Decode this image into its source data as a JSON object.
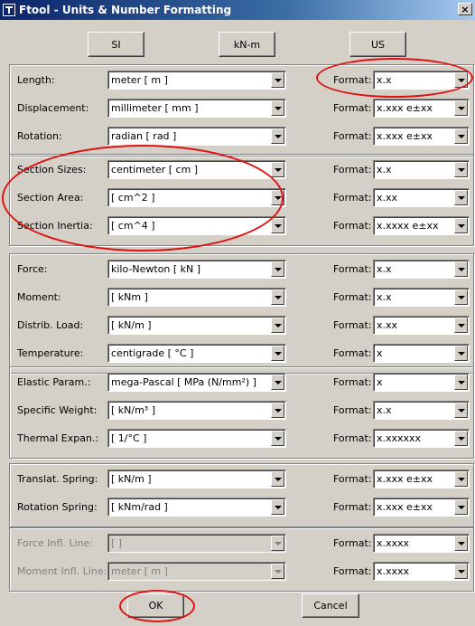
{
  "window": {
    "title": "Ftool - Units & Number Formatting",
    "close_glyph": "×"
  },
  "presets": {
    "si": "SI",
    "kn": "kN-m",
    "us": "US"
  },
  "format_label": "Format:",
  "groups": [
    {
      "rows": [
        {
          "label": "Length:",
          "unit": "meter [ m ]",
          "format": "x.x"
        },
        {
          "label": "Displacement:",
          "unit": "millimeter [ mm ]",
          "format": "x.xxx e±xx"
        },
        {
          "label": "Rotation:",
          "unit": "radian [ rad ]",
          "format": "x.xxx e±xx"
        }
      ]
    },
    {
      "rows": [
        {
          "label": "Section Sizes:",
          "unit": "centimeter [ cm ]",
          "format": "x.x"
        },
        {
          "label": "Section Area:",
          "unit": "[ cm^2 ]",
          "format": "x.xx"
        },
        {
          "label": "Section Inertia:",
          "unit": "[ cm^4 ]",
          "format": "x.xxxx e±xx"
        }
      ]
    },
    {
      "rows": [
        {
          "label": "Force:",
          "unit": "kilo-Newton [ kN ]",
          "format": "x.x"
        },
        {
          "label": "Moment:",
          "unit": "[ kNm ]",
          "format": "x.x"
        },
        {
          "label": "Distrib. Load:",
          "unit": "[ kN/m ]",
          "format": "x.xx"
        },
        {
          "label": "Temperature:",
          "unit": "centigrade [ °C ]",
          "format": "x"
        }
      ]
    },
    {
      "rows": [
        {
          "label": "Elastic Param.:",
          "unit": "mega-Pascal [ MPa (N/mm²) ]",
          "format": "x"
        },
        {
          "label": "Specific Weight:",
          "unit": "[ kN/m³ ]",
          "format": "x.x"
        },
        {
          "label": "Thermal Expan.:",
          "unit": "[ 1/°C ]",
          "format": "x.xxxxxx"
        }
      ]
    },
    {
      "rows": [
        {
          "label": "Translat. Spring:",
          "unit": "[ kN/m ]",
          "format": "x.xxx e±xx"
        },
        {
          "label": "Rotation Spring:",
          "unit": "[ kNm/rad ]",
          "format": "x.xxx e±xx"
        }
      ]
    },
    {
      "rows": [
        {
          "label": "Force Infl. Line:",
          "unit": "[ ]",
          "format": "x.xxxx",
          "disabled": true
        },
        {
          "label": "Moment Infl. Line:",
          "unit": "meter [ m ]",
          "format": "x.xxxx",
          "disabled": true
        }
      ]
    }
  ],
  "footer": {
    "ok": "OK",
    "cancel": "Cancel"
  },
  "colors": {
    "titlebar": "#0a246a",
    "dialog": "#d4d0c8",
    "annotation": "#e01010"
  },
  "icons": {
    "app": "ftool-app-icon",
    "close": "close-icon",
    "dropdown": "chevron-down-icon"
  }
}
